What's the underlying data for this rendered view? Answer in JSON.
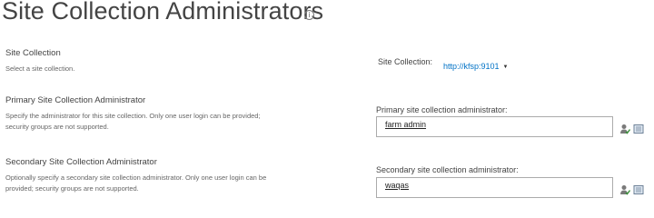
{
  "page": {
    "title": "Site Collection Administrators",
    "info_icon": "info-icon"
  },
  "sections": {
    "site_collection": {
      "title": "Site Collection",
      "description": "Select a site collection.",
      "label": "Site Collection:",
      "selected_value": "http://kfsp:9101",
      "dropdown_icon": "caret-down-icon"
    },
    "primary": {
      "title": "Primary Site Collection Administrator",
      "description_line1": "Specify the administrator for this site collection. Only one user login can be provided;",
      "description_line2": "security groups are not supported.",
      "label": "Primary site collection administrator:",
      "value": "farm admin"
    },
    "secondary": {
      "title": "Secondary Site Collection Administrator",
      "description_line1": "Optionally specify a secondary site collection administrator. Only one user login can be",
      "description_line2": "provided; security groups are not supported.",
      "label": "Secondary site collection administrator:",
      "value": "waqas"
    }
  },
  "icons": {
    "check_names": "check-names-icon",
    "browse": "address-book-icon"
  },
  "colors": {
    "link": "#0072c6",
    "title_text": "#444444",
    "input_border": "#ababab"
  }
}
